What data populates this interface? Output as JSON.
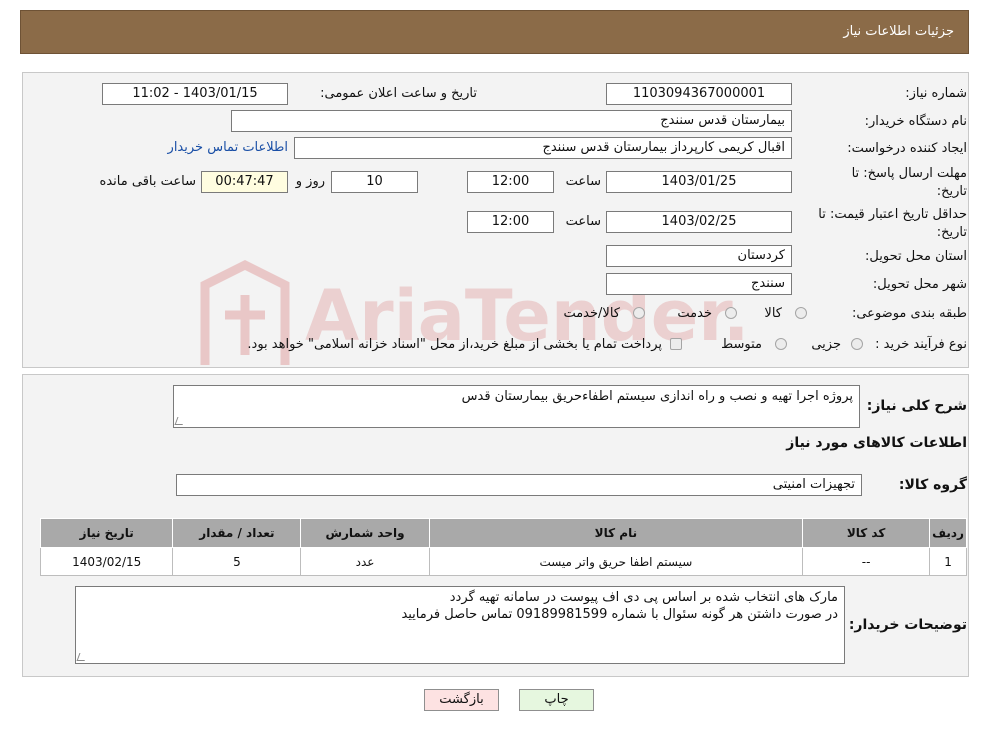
{
  "header": {
    "title": "جزئیات اطلاعات نیاز"
  },
  "watermark": {
    "text": "AriaTender.neT"
  },
  "details": {
    "need_number_label": "شماره نیاز:",
    "need_number": "1103094367000001",
    "announce_label": "تاریخ و ساعت اعلان عمومی:",
    "announce_value": "1403/01/15 - 11:02",
    "buyer_org_label": "نام دستگاه خریدار:",
    "buyer_org": "بیمارستان قدس سنندج",
    "creator_label": "ایجاد کننده درخواست:",
    "creator": "اقبال کریمی کارپرداز بیمارستان قدس سنندج",
    "contact_link": "اطلاعات تماس خریدار",
    "deadline_label_1": "مهلت ارسال پاسخ: تا",
    "deadline_label_2": "تاریخ:",
    "deadline_date": "1403/01/25",
    "time_label": "ساعت",
    "deadline_time": "12:00",
    "days_value": "10",
    "days_label": "روز و",
    "remaining_time": "00:47:47",
    "remaining_label": "ساعت باقی مانده",
    "price_valid_label_1": "حداقل تاریخ اعتبار قیمت: تا",
    "price_valid_label_2": "تاریخ:",
    "price_valid_date": "1403/02/25",
    "price_valid_time": "12:00",
    "province_label": "استان محل تحویل:",
    "province": "کردستان",
    "city_label": "شهر محل تحویل:",
    "city": "سنندج",
    "category_label": "طبقه بندی موضوعی:",
    "category_options": [
      "کالا",
      "خدمت",
      "کالا/خدمت"
    ],
    "process_label": "نوع فرآیند خرید :",
    "process_options": [
      "جزیی",
      "متوسط"
    ],
    "payment_note": "پرداخت تمام یا بخشی از مبلغ خرید،از محل \"اسناد خزانه اسلامی\" خواهد بود."
  },
  "summary": {
    "desc_label": "شرح کلی نیاز:",
    "desc": "پروژه اجرا  تهیه و نصب و راه اندازی سیستم اطفاءحریق بیمارستان قدس",
    "items_title": "اطلاعات کالاهای مورد نیاز",
    "group_label": "گروه کالا:",
    "group": "تجهیزات امنیتی"
  },
  "table": {
    "headers": [
      "ردیف",
      "کد کالا",
      "نام کالا",
      "واحد شمارش",
      "تعداد / مقدار",
      "تاریخ نیاز"
    ],
    "rows": [
      [
        "1",
        "--",
        "سیستم اطفا حریق واتر میست",
        "عدد",
        "5",
        "1403/02/15"
      ]
    ]
  },
  "buyer_notes": {
    "label": "توضیحات خریدار:",
    "line1": "مارک های انتخاب شده بر اساس پی دی اف پیوست در سامانه تهیه گردد",
    "line2": "در صورت داشتن هر گونه سئوال با شماره 09189981599 تماس حاصل فرمایید"
  },
  "buttons": {
    "print": "چاپ",
    "back": "بازگشت"
  },
  "colors": {
    "header_bg": "#8b6b48",
    "back_btn": "#fde2e2",
    "print_btn": "#e6f7df",
    "link": "#1a4fa6"
  }
}
